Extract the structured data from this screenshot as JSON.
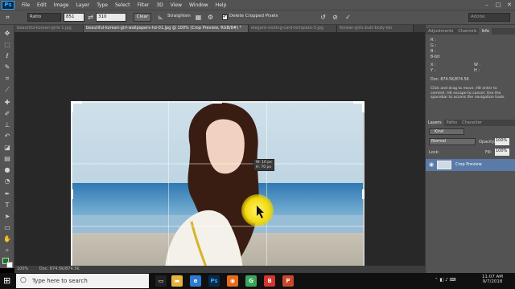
{
  "app": {
    "logo": "Ps",
    "menu": [
      "File",
      "Edit",
      "Image",
      "Layer",
      "Type",
      "Select",
      "Filter",
      "3D",
      "View",
      "Window",
      "Help"
    ]
  },
  "options_bar": {
    "ratio_label": "Ratio",
    "width_value": "851",
    "height_value": "310",
    "clear_label": "Clear",
    "straighten_label": "Straighten",
    "delete_cropped_label": "Delete Cropped Pixels",
    "delete_cropped_checked": true,
    "workspace_value": "Adobe"
  },
  "tabs": [
    {
      "label": "beautiful-korean-girls-1.jpg",
      "active": false
    },
    {
      "label": "beautiful-korean-girl-wallpapers-hd-01.jpg @ 100% (Crop Preview, RGB/8#) *",
      "active": true
    },
    {
      "label": "elegant-visiting-card-template-3.jpg",
      "active": false
    },
    {
      "label": "Korean-girls-butt-body-idn",
      "active": false
    }
  ],
  "crop_tooltip": {
    "w": "W: 10 px",
    "h": "H: 70 px"
  },
  "status_bar": {
    "zoom": "100%",
    "doc": "Doc: 874.5K/874.5K"
  },
  "info_panel": {
    "tabs": [
      "Adjustments",
      "Channels",
      "Info"
    ],
    "rgb_labels": [
      "R :",
      "G :",
      "B :"
    ],
    "bit_label": "8-bit",
    "xy_labels": [
      "X :",
      "Y :"
    ],
    "wh_labels": [
      "W :",
      "H :"
    ],
    "doc": "Doc: 874.5K/874.5K",
    "help": "Click and drag to move. Hit enter to commit. Hit escape to cancel. Use the spacebar to access the navigation tools."
  },
  "layers_panel": {
    "tabs": [
      "Layers",
      "Paths",
      "Character"
    ],
    "kind": "Kind",
    "blend_mode": "Normal",
    "opacity_label": "Opacity:",
    "opacity_value": "100%",
    "lock_label": "Lock:",
    "fill_label": "Fill:",
    "fill_value": "100%",
    "layer_name": "Crop Preview"
  },
  "taskbar": {
    "search_placeholder": "Type here to search",
    "time": "11:07 AM",
    "date": "9/7/2018",
    "apps": [
      {
        "icon": "task-view-icon",
        "color": "#222222"
      },
      {
        "icon": "file-explorer-icon",
        "color": "#e8b33d"
      },
      {
        "icon": "edge-icon",
        "color": "#2f7bd1"
      },
      {
        "icon": "camtasia-icon",
        "color": "#2e8b3d"
      },
      {
        "icon": "photoshop-icon",
        "color": "#0a2a47"
      },
      {
        "icon": "firefox-icon",
        "color": "#e86b1a"
      },
      {
        "icon": "chrome-icon",
        "color": "#3aa55a"
      },
      {
        "icon": "bandicam-icon",
        "color": "#d5352c"
      },
      {
        "icon": "powerpoint-icon",
        "color": "#c9482b"
      }
    ]
  },
  "colors": {
    "foreground": "#0d7a1f",
    "background": "#ffffff"
  }
}
